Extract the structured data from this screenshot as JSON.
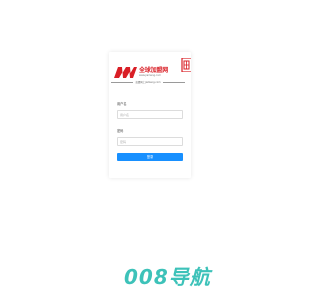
{
  "logo": {
    "cn_name": "全球加盟网",
    "en_url": "www.jiameng.com",
    "tagline": "加盟网上jiameng.com"
  },
  "form": {
    "username_label": "用户名",
    "username_placeholder": "用户名",
    "password_label": "密码",
    "password_placeholder": "密码",
    "submit_label": "登录"
  },
  "footer": {
    "brand": "008导航"
  },
  "colors": {
    "brand_red": "#d91f26",
    "button_blue": "#1890ff",
    "footer_teal": "#3dc2b9"
  }
}
